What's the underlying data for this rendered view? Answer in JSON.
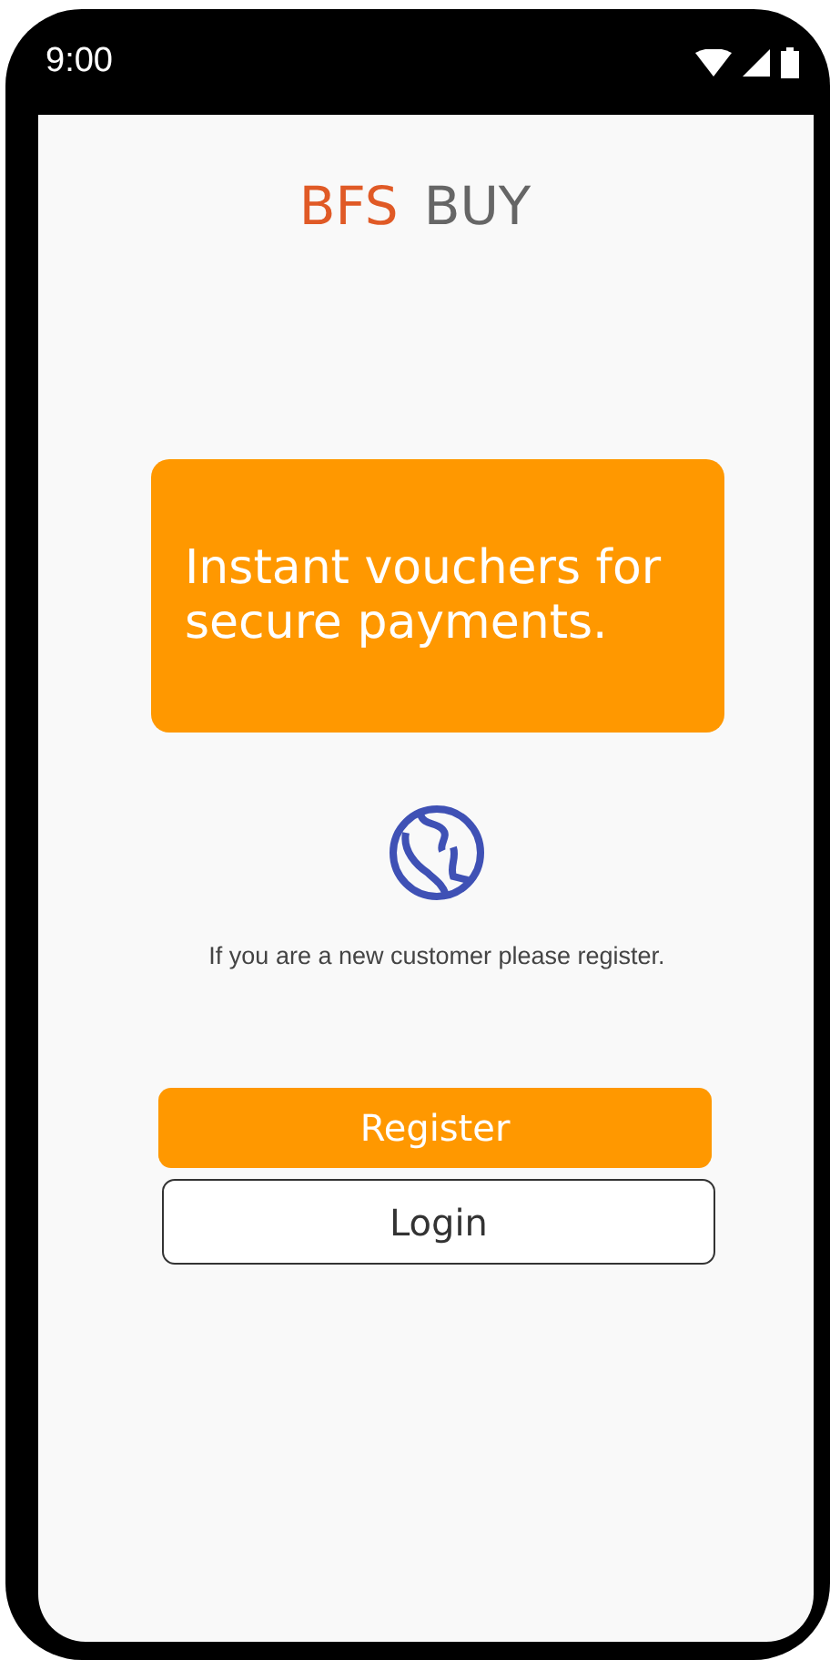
{
  "status_bar": {
    "time": "9:00"
  },
  "logo": {
    "first": "BFS",
    "second": "BUY"
  },
  "banner": {
    "text": "Instant vouchers for secure payments."
  },
  "hint": "If you are a new customer please register.",
  "buttons": [
    {
      "label": "Register",
      "kind": "primary"
    },
    {
      "label": "Login",
      "kind": "outline"
    }
  ]
}
